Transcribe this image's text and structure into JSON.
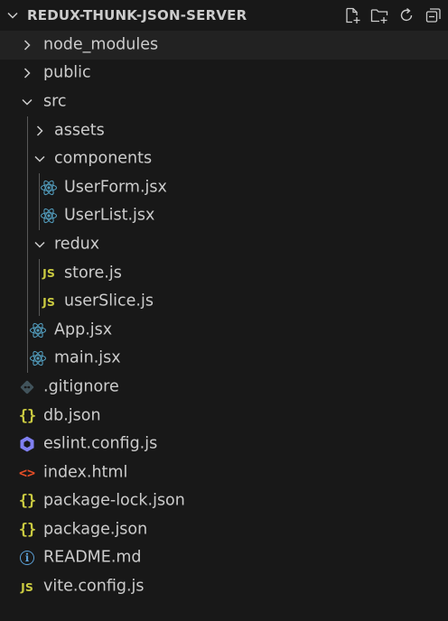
{
  "explorer": {
    "title": "REDUX-THUNK-JSON-SERVER",
    "actions": [
      {
        "name": "new-file",
        "icon": "new-file-icon"
      },
      {
        "name": "new-folder",
        "icon": "new-folder-icon"
      },
      {
        "name": "refresh",
        "icon": "refresh-icon"
      },
      {
        "name": "collapse-all",
        "icon": "collapse-all-icon"
      }
    ]
  },
  "tree": [
    {
      "label": "node_modules",
      "kind": "folder",
      "expanded": false,
      "depth": 0
    },
    {
      "label": "public",
      "kind": "folder",
      "expanded": false,
      "depth": 0
    },
    {
      "label": "src",
      "kind": "folder",
      "expanded": true,
      "depth": 0
    },
    {
      "label": "assets",
      "kind": "folder",
      "expanded": false,
      "depth": 1
    },
    {
      "label": "components",
      "kind": "folder",
      "expanded": true,
      "depth": 1
    },
    {
      "label": "UserForm.jsx",
      "kind": "file",
      "icon": "react-icon",
      "depth": 2
    },
    {
      "label": "UserList.jsx",
      "kind": "file",
      "icon": "react-icon",
      "depth": 2
    },
    {
      "label": "redux",
      "kind": "folder",
      "expanded": true,
      "depth": 1
    },
    {
      "label": "store.js",
      "kind": "file",
      "icon": "javascript-icon",
      "depth": 2
    },
    {
      "label": "userSlice.js",
      "kind": "file",
      "icon": "javascript-icon",
      "depth": 2
    },
    {
      "label": "App.jsx",
      "kind": "file",
      "icon": "react-icon",
      "depth": 1
    },
    {
      "label": "main.jsx",
      "kind": "file",
      "icon": "react-icon",
      "depth": 1
    },
    {
      "label": ".gitignore",
      "kind": "file",
      "icon": "git-icon",
      "depth": 0
    },
    {
      "label": "db.json",
      "kind": "file",
      "icon": "json-icon",
      "depth": 0
    },
    {
      "label": "eslint.config.js",
      "kind": "file",
      "icon": "eslint-icon",
      "depth": 0
    },
    {
      "label": "index.html",
      "kind": "file",
      "icon": "html-icon",
      "depth": 0
    },
    {
      "label": "package-lock.json",
      "kind": "file",
      "icon": "json-icon",
      "depth": 0
    },
    {
      "label": "package.json",
      "kind": "file",
      "icon": "json-icon",
      "depth": 0
    },
    {
      "label": "README.md",
      "kind": "file",
      "icon": "info-icon",
      "depth": 0
    },
    {
      "label": "vite.config.js",
      "kind": "file",
      "icon": "javascript-icon",
      "depth": 0
    }
  ],
  "colors": {
    "background": "#181818",
    "text": "#cccccc",
    "selected_row": "#222222",
    "react": "#519aba",
    "javascript": "#cbcb41",
    "json": "#cbcb41",
    "html": "#e44d26",
    "eslint": "#8080f2",
    "git": "#41535b",
    "info": "#5ba0d6"
  }
}
